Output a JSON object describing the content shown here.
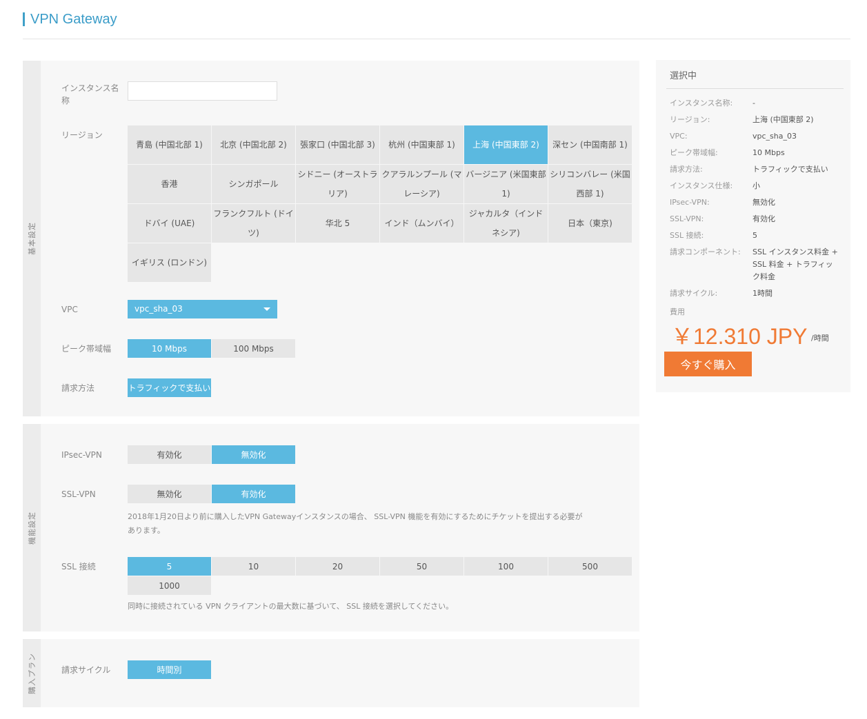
{
  "page": {
    "title": "VPN Gateway"
  },
  "basic": {
    "section_label": "基本設定",
    "instance_name_label": "インスタンス名称",
    "instance_name_value": "",
    "region_label": "リージョン",
    "regions": [
      "青島 (中国北部 1)",
      "北京 (中国北部 2)",
      "張家口 (中国北部 3)",
      "杭州 (中国東部 1)",
      "上海 (中国東部 2)",
      "深セン (中国南部 1)",
      "香港",
      "シンガポール",
      "シドニー (オーストラリア)",
      "クアラルンプール (マレーシア)",
      "バージニア (米国東部 1)",
      "シリコンバレー (米国西部 1)",
      "ドバイ (UAE)",
      "フランクフルト (ドイツ)",
      "华北 5",
      "インド（ムンバイ）",
      "ジャカルタ（インドネシア)",
      "日本（東京)",
      "イギリス (ロンドン)"
    ],
    "selected_region": "上海 (中国東部 2)",
    "vpc_label": "VPC",
    "vpc_value": "vpc_sha_03",
    "bandwidth_label": "ピーク帯域幅",
    "bandwidth_options": [
      "10 Mbps",
      "100 Mbps"
    ],
    "bandwidth_selected": "10 Mbps",
    "billing_method_label": "請求方法",
    "billing_method_option": "トラフィックで支払い"
  },
  "features": {
    "section_label": "機能設定",
    "ipsec_label": "IPsec-VPN",
    "ipsec_options": [
      "有効化",
      "無効化"
    ],
    "ipsec_selected": "無効化",
    "ssl_vpn_label": "SSL-VPN",
    "ssl_vpn_options": [
      "無効化",
      "有効化"
    ],
    "ssl_vpn_selected": "有効化",
    "ssl_vpn_note_line1": "2018年1月20日より前に購入したVPN Gatewayインスタンスの場合、 SSL-VPN 機能を有効にするためにチケットを提出する必要が",
    "ssl_vpn_note_line2": "あります。",
    "ssl_conn_label": "SSL 接続",
    "ssl_conn_options": [
      "5",
      "10",
      "20",
      "50",
      "100",
      "500",
      "1000"
    ],
    "ssl_conn_selected": "5",
    "ssl_conn_note": "同時に接続されている VPN クライアントの最大数に基づいて、 SSL 接続を選択してください。"
  },
  "purchase": {
    "section_label": "購入プラン",
    "billing_cycle_label": "請求サイクル",
    "billing_cycle_option": "時間別"
  },
  "summary": {
    "heading": "選択中",
    "rows": [
      {
        "key": "インスタンス名称:",
        "value": "-"
      },
      {
        "key": "リージョン:",
        "value": "上海 (中国東部 2)"
      },
      {
        "key": "VPC:",
        "value": "vpc_sha_03"
      },
      {
        "key": "ピーク帯域幅:",
        "value": "10 Mbps"
      },
      {
        "key": "請求方法:",
        "value": "トラフィックで支払い"
      },
      {
        "key": "インスタンス仕様:",
        "value": "小"
      },
      {
        "key": "IPsec-VPN:",
        "value": "無効化"
      },
      {
        "key": "SSL-VPN:",
        "value": "有効化"
      },
      {
        "key": "SSL 接続:",
        "value": "5"
      },
      {
        "key": "請求コンポーネント:",
        "value": "SSL インスタンス料金 + SSL 料金 + トラフィック料金"
      },
      {
        "key": "請求サイクル:",
        "value": "1時間"
      }
    ],
    "cost_label": "費用",
    "price": "￥12.310 JPY",
    "price_unit": "/時間",
    "buy_button": "今すぐ購入"
  },
  "colors": {
    "accent": "#5bb9e0",
    "title": "#3a9cc8",
    "price": "#f07a34",
    "buy": "#f07a34"
  }
}
